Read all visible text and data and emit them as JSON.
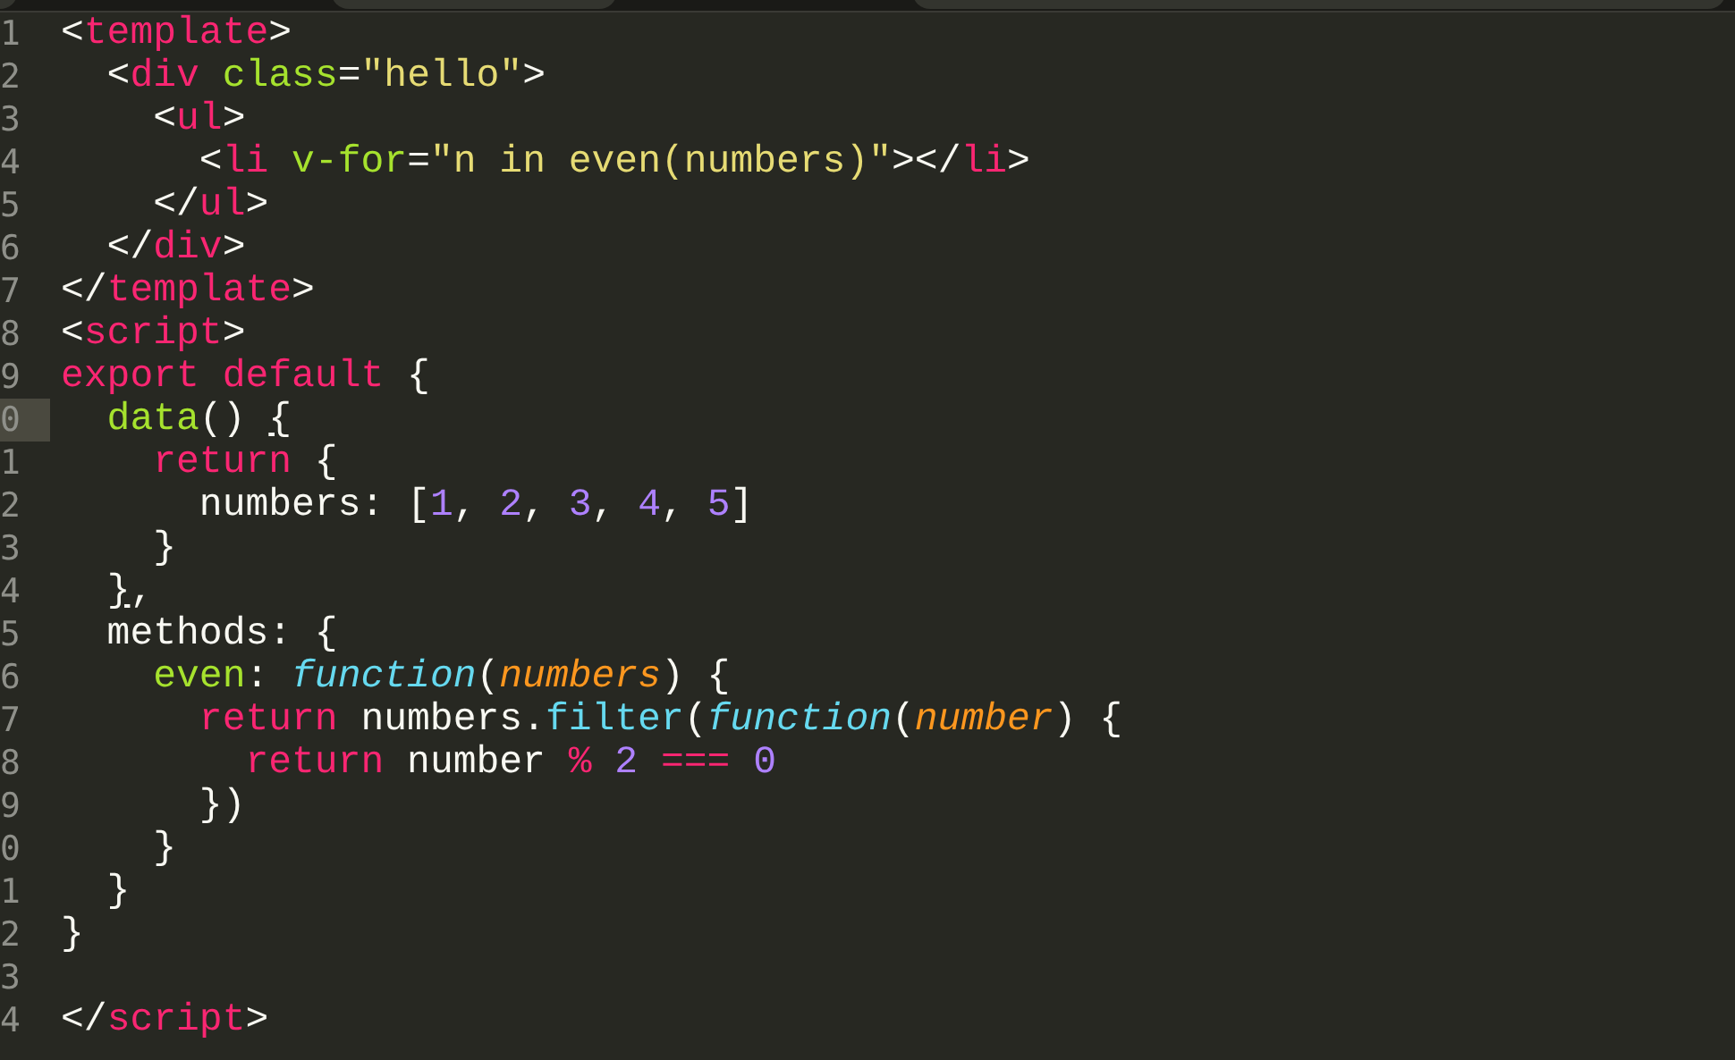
{
  "editor": {
    "lines": [
      {
        "number": "1",
        "current": false,
        "tokens": [
          {
            "kind": "punct",
            "text": "<"
          },
          {
            "kind": "tag",
            "text": "template"
          },
          {
            "kind": "punct",
            "text": ">"
          }
        ]
      },
      {
        "number": "2",
        "current": false,
        "tokens": [
          {
            "kind": "punct",
            "text": "  <"
          },
          {
            "kind": "tag",
            "text": "div"
          },
          {
            "kind": "attr",
            "text": " class"
          },
          {
            "kind": "punct",
            "text": "="
          },
          {
            "kind": "string",
            "text": "\"hello\""
          },
          {
            "kind": "punct",
            "text": ">"
          }
        ]
      },
      {
        "number": "3",
        "current": false,
        "tokens": [
          {
            "kind": "punct",
            "text": "    <"
          },
          {
            "kind": "tag",
            "text": "ul"
          },
          {
            "kind": "punct",
            "text": ">"
          }
        ]
      },
      {
        "number": "4",
        "current": false,
        "tokens": [
          {
            "kind": "punct",
            "text": "      <"
          },
          {
            "kind": "tag",
            "text": "li"
          },
          {
            "kind": "attr",
            "text": " v-for"
          },
          {
            "kind": "punct",
            "text": "="
          },
          {
            "kind": "string",
            "text": "\"n in even(numbers)\""
          },
          {
            "kind": "punct",
            "text": "></"
          },
          {
            "kind": "tag",
            "text": "li"
          },
          {
            "kind": "punct",
            "text": ">"
          }
        ]
      },
      {
        "number": "5",
        "current": false,
        "tokens": [
          {
            "kind": "punct",
            "text": "    </"
          },
          {
            "kind": "tag",
            "text": "ul"
          },
          {
            "kind": "punct",
            "text": ">"
          }
        ]
      },
      {
        "number": "6",
        "current": false,
        "tokens": [
          {
            "kind": "punct",
            "text": "  </"
          },
          {
            "kind": "tag",
            "text": "div"
          },
          {
            "kind": "punct",
            "text": ">"
          }
        ]
      },
      {
        "number": "7",
        "current": false,
        "tokens": [
          {
            "kind": "punct",
            "text": "</"
          },
          {
            "kind": "tag",
            "text": "template"
          },
          {
            "kind": "punct",
            "text": ">"
          }
        ]
      },
      {
        "number": "8",
        "current": false,
        "tokens": [
          {
            "kind": "punct",
            "text": "<"
          },
          {
            "kind": "tag",
            "text": "script"
          },
          {
            "kind": "punct",
            "text": ">"
          }
        ]
      },
      {
        "number": "9",
        "current": false,
        "tokens": [
          {
            "kind": "keyword",
            "text": "export"
          },
          {
            "kind": "keyword",
            "text": " default"
          },
          {
            "kind": "plain",
            "text": " {"
          }
        ]
      },
      {
        "number": "0",
        "current": true,
        "tokens": [
          {
            "kind": "func",
            "text": "  data"
          },
          {
            "kind": "plain",
            "text": "() "
          },
          {
            "kind": "bracket-match",
            "text": "{"
          }
        ]
      },
      {
        "number": "1",
        "current": false,
        "tokens": [
          {
            "kind": "keyword",
            "text": "    return"
          },
          {
            "kind": "plain",
            "text": " {"
          }
        ]
      },
      {
        "number": "2",
        "current": false,
        "tokens": [
          {
            "kind": "plain",
            "text": "      numbers: ["
          },
          {
            "kind": "number",
            "text": "1"
          },
          {
            "kind": "plain",
            "text": ", "
          },
          {
            "kind": "number",
            "text": "2"
          },
          {
            "kind": "plain",
            "text": ", "
          },
          {
            "kind": "number",
            "text": "3"
          },
          {
            "kind": "plain",
            "text": ", "
          },
          {
            "kind": "number",
            "text": "4"
          },
          {
            "kind": "plain",
            "text": ", "
          },
          {
            "kind": "number",
            "text": "5"
          },
          {
            "kind": "plain",
            "text": "]"
          }
        ]
      },
      {
        "number": "3",
        "current": false,
        "tokens": [
          {
            "kind": "plain",
            "text": "    }"
          }
        ]
      },
      {
        "number": "4",
        "current": false,
        "tokens": [
          {
            "kind": "bracket-match",
            "text": "  }"
          },
          {
            "kind": "plain",
            "text": ","
          }
        ]
      },
      {
        "number": "5",
        "current": false,
        "tokens": [
          {
            "kind": "plain",
            "text": "  methods: {"
          }
        ]
      },
      {
        "number": "6",
        "current": false,
        "tokens": [
          {
            "kind": "func",
            "text": "    even"
          },
          {
            "kind": "plain",
            "text": ": "
          },
          {
            "kind": "storage",
            "text": "function"
          },
          {
            "kind": "plain",
            "text": "("
          },
          {
            "kind": "param",
            "text": "numbers"
          },
          {
            "kind": "plain",
            "text": ") {"
          }
        ]
      },
      {
        "number": "7",
        "current": false,
        "tokens": [
          {
            "kind": "keyword",
            "text": "      return"
          },
          {
            "kind": "plain",
            "text": " numbers."
          },
          {
            "kind": "support",
            "text": "filter"
          },
          {
            "kind": "plain",
            "text": "("
          },
          {
            "kind": "storage",
            "text": "function"
          },
          {
            "kind": "plain",
            "text": "("
          },
          {
            "kind": "param",
            "text": "number"
          },
          {
            "kind": "plain",
            "text": ") {"
          }
        ]
      },
      {
        "number": "8",
        "current": false,
        "tokens": [
          {
            "kind": "keyword",
            "text": "        return"
          },
          {
            "kind": "plain",
            "text": " number "
          },
          {
            "kind": "operator",
            "text": "%"
          },
          {
            "kind": "number",
            "text": " 2"
          },
          {
            "kind": "operator",
            "text": " ==="
          },
          {
            "kind": "number",
            "text": " 0"
          }
        ]
      },
      {
        "number": "9",
        "current": false,
        "tokens": [
          {
            "kind": "plain",
            "text": "      })"
          }
        ]
      },
      {
        "number": "0",
        "current": false,
        "tokens": [
          {
            "kind": "plain",
            "text": "    }"
          }
        ]
      },
      {
        "number": "1",
        "current": false,
        "tokens": [
          {
            "kind": "plain",
            "text": "  }"
          }
        ]
      },
      {
        "number": "2",
        "current": false,
        "tokens": [
          {
            "kind": "plain",
            "text": "}"
          }
        ]
      },
      {
        "number": "3",
        "current": false
      },
      {
        "number": "4",
        "current": false,
        "tokens": [
          {
            "kind": "punct",
            "text": "</"
          },
          {
            "kind": "tag",
            "text": "script"
          },
          {
            "kind": "punct",
            "text": ">"
          }
        ]
      }
    ]
  }
}
